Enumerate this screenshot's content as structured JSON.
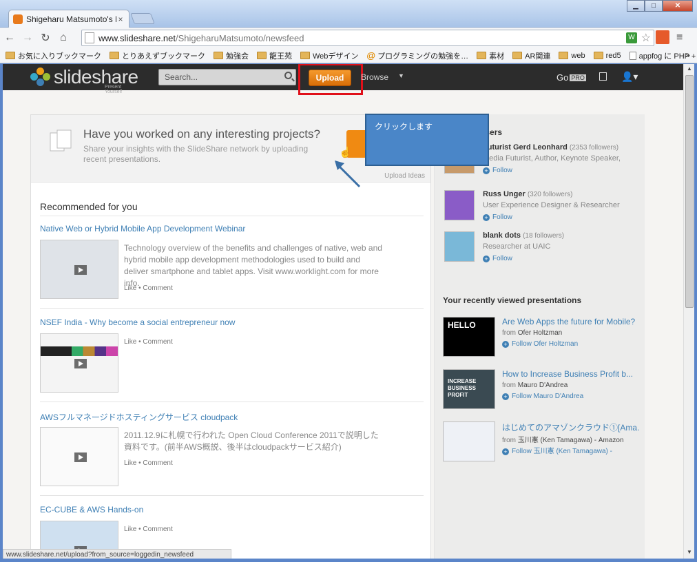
{
  "browser": {
    "tab_title": "Shigeharu Matsumoto's Ne",
    "tab_close": "×",
    "url_host": "www.slideshare.net",
    "url_path": "/ShigeharuMatsumoto/newsfeed",
    "status_url": "www.slideshare.net/upload?from_source=loggedin_newsfeed",
    "win_min": "▁",
    "win_max": "□",
    "win_close": "✕",
    "ext_label": "W",
    "bookmark_overflow": "»",
    "bookmarks": [
      {
        "label": "お気に入りブックマーク",
        "icon": "folder-icon"
      },
      {
        "label": "とりあえずブックマーク",
        "icon": "folder-icon"
      },
      {
        "label": "勉強会",
        "icon": "folder-icon"
      },
      {
        "label": "龍王苑",
        "icon": "folder-icon"
      },
      {
        "label": "Webデザイン",
        "icon": "folder-icon"
      },
      {
        "label": "プログラミングの勉強を…",
        "icon": "at-icon"
      },
      {
        "label": "素材",
        "icon": "folder-icon"
      },
      {
        "label": "AR関連",
        "icon": "folder-icon"
      },
      {
        "label": "web",
        "icon": "folder-icon"
      },
      {
        "label": "red5",
        "icon": "folder-icon"
      },
      {
        "label": "appfog に PHP + My…",
        "icon": "page-icon"
      }
    ]
  },
  "header": {
    "logo_text": "slideshare",
    "logo_tagline": "Present Yourself",
    "search_placeholder": "Search...",
    "upload_label": "Upload",
    "browse_label": "Browse",
    "go_label": "Go",
    "pro_label": "PRO"
  },
  "annotation": {
    "callout_text": "クリックします"
  },
  "promo": {
    "title": "Have you worked on any interesting projects?",
    "text": "Share your insights with the SlideShare network by uploading recent presentations.",
    "ideas_link": "Upload Ideas"
  },
  "feed": {
    "heading": "Recommended for you",
    "like_label": "Like",
    "comment_label": "Comment",
    "items": [
      {
        "title": "Native Web or Hybrid Mobile App Development Webinar",
        "desc": "Technology overview of the benefits and challenges of native, web and hybrid mobile app development methodologies used to build and deliver smartphone and tablet apps. Visit www.worklight.com for more info."
      },
      {
        "title": "NSEF India - Why become a social entrepreneur now",
        "desc": ""
      },
      {
        "title": "AWSフルマネージドホスティングサービス cloudpack",
        "desc": "2011.12.9に札幌で行われた Open Cloud Conference 2011で説明した資料です。(前半AWS概説、後半はcloudpackサービス紹介)"
      },
      {
        "title": "EC-CUBE & AWS Hands-on",
        "desc": ""
      }
    ]
  },
  "featured": {
    "heading": "Featured users",
    "follow_label": "Follow",
    "users": [
      {
        "name": "Futurist Gerd Leonhard",
        "followers": "(2353 followers)",
        "bio": "Media Futurist, Author, Keynote Speaker,"
      },
      {
        "name": "Russ Unger",
        "followers": "(320 followers)",
        "bio": "User Experience Designer & Researcher"
      },
      {
        "name": "blank dots",
        "followers": "(18 followers)",
        "bio": "Researcher at UAIC"
      }
    ]
  },
  "recent": {
    "heading": "Your recently viewed presentations",
    "from_label": "from",
    "items": [
      {
        "title": "Are Web Apps the future for Mobile?",
        "author": "Ofer Holtzman",
        "follow": "Follow Ofer Holtzman",
        "thumb_text": "HELLO"
      },
      {
        "title": "How to Increase Business Profit b...",
        "author": "Mauro D'Andrea",
        "follow": "Follow Mauro D'Andrea",
        "thumb_text": "INCREASE BUSINESS PROFIT"
      },
      {
        "title": "はじめてのアマゾンクラウド①[Ama...",
        "author": "玉川憲 (Ken Tamagawa) - Amazon",
        "follow": "Follow 玉川憲 (Ken Tamagawa) -",
        "thumb_text": ""
      }
    ]
  }
}
